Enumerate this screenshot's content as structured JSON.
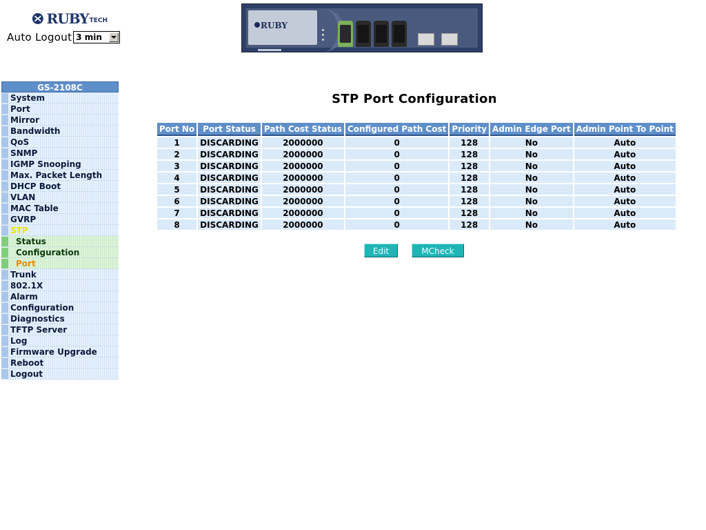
{
  "logo": {
    "text": "RUBY",
    "sub": "TECH"
  },
  "auto_logout": {
    "label": "Auto Logout",
    "value": "3 min"
  },
  "device": {
    "brand": "RUBY"
  },
  "menu": {
    "title": "GS-2108C",
    "items": [
      {
        "label": "System"
      },
      {
        "label": "Port"
      },
      {
        "label": "Mirror"
      },
      {
        "label": "Bandwidth"
      },
      {
        "label": "QoS"
      },
      {
        "label": "SNMP"
      },
      {
        "label": "IGMP Snooping"
      },
      {
        "label": "Max. Packet Length"
      },
      {
        "label": "DHCP Boot"
      },
      {
        "label": "VLAN"
      },
      {
        "label": "MAC Table"
      },
      {
        "label": "GVRP"
      },
      {
        "label": "STP",
        "state": "active-parent"
      },
      {
        "label": "Status",
        "state": "sub"
      },
      {
        "label": "Configuration",
        "state": "sub"
      },
      {
        "label": "Port",
        "state": "sub current"
      },
      {
        "label": "Trunk"
      },
      {
        "label": "802.1X"
      },
      {
        "label": "Alarm"
      },
      {
        "label": "Configuration"
      },
      {
        "label": "Diagnostics"
      },
      {
        "label": "TFTP Server"
      },
      {
        "label": "Log"
      },
      {
        "label": "Firmware Upgrade"
      },
      {
        "label": "Reboot"
      },
      {
        "label": "Logout"
      }
    ]
  },
  "page": {
    "title": "STP Port Configuration"
  },
  "table": {
    "headers": [
      "Port No",
      "Port Status",
      "Path Cost Status",
      "Configured Path Cost",
      "Priority",
      "Admin Edge Port",
      "Admin Point To Point"
    ],
    "rows": [
      [
        "1",
        "DISCARDING",
        "2000000",
        "0",
        "128",
        "No",
        "Auto"
      ],
      [
        "2",
        "DISCARDING",
        "2000000",
        "0",
        "128",
        "No",
        "Auto"
      ],
      [
        "3",
        "DISCARDING",
        "2000000",
        "0",
        "128",
        "No",
        "Auto"
      ],
      [
        "4",
        "DISCARDING",
        "2000000",
        "0",
        "128",
        "No",
        "Auto"
      ],
      [
        "5",
        "DISCARDING",
        "2000000",
        "0",
        "128",
        "No",
        "Auto"
      ],
      [
        "6",
        "DISCARDING",
        "2000000",
        "0",
        "128",
        "No",
        "Auto"
      ],
      [
        "7",
        "DISCARDING",
        "2000000",
        "0",
        "128",
        "No",
        "Auto"
      ],
      [
        "8",
        "DISCARDING",
        "2000000",
        "0",
        "128",
        "No",
        "Auto"
      ]
    ]
  },
  "buttons": {
    "edit": "Edit",
    "mcheck": "MCheck"
  },
  "colors": {
    "header_blue": "#5f8fc9",
    "cell_blue": "#dbeaf9",
    "button_teal": "#1fb5b5",
    "active_yellow": "#e6e600",
    "current_orange": "#e88a00"
  }
}
